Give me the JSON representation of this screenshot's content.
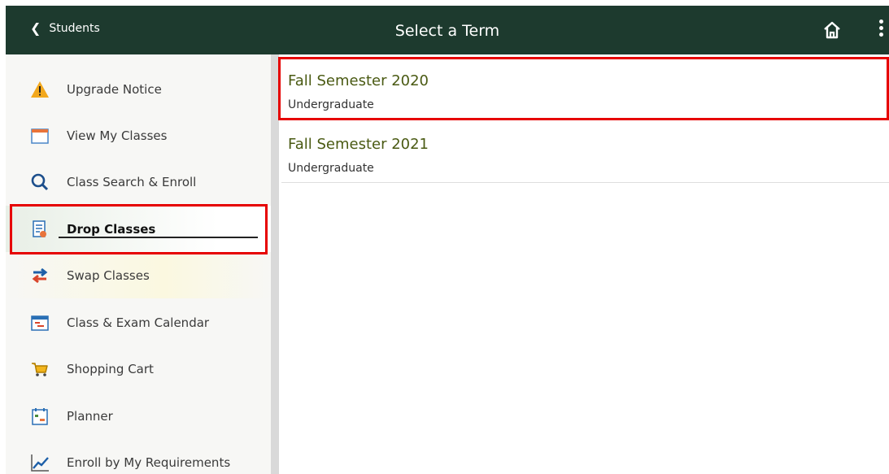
{
  "header": {
    "back_label": "Students",
    "title": "Select a Term",
    "home_icon": "home-icon",
    "menu_icon": "kebab-menu-icon"
  },
  "sidebar": {
    "items": [
      {
        "label": "Upgrade Notice",
        "icon": "warning-icon"
      },
      {
        "label": "View My Classes",
        "icon": "calendar-icon"
      },
      {
        "label": "Class Search & Enroll",
        "icon": "search-icon"
      },
      {
        "label": "Drop Classes",
        "icon": "drop-document-icon",
        "selected": true
      },
      {
        "label": "Swap Classes",
        "icon": "swap-arrows-icon"
      },
      {
        "label": "Class & Exam Calendar",
        "icon": "exam-calendar-icon"
      },
      {
        "label": "Shopping Cart",
        "icon": "shopping-cart-icon"
      },
      {
        "label": "Planner",
        "icon": "planner-icon"
      },
      {
        "label": "Enroll by My Requirements",
        "icon": "trend-chart-icon"
      }
    ]
  },
  "terms": [
    {
      "name": "Fall Semester 2020",
      "career": "Undergraduate"
    },
    {
      "name": "Fall Semester 2021",
      "career": "Undergraduate"
    }
  ],
  "colors": {
    "header_bg": "#1d3a2e",
    "term_title": "#4a5a13",
    "highlight": "#e60000"
  }
}
